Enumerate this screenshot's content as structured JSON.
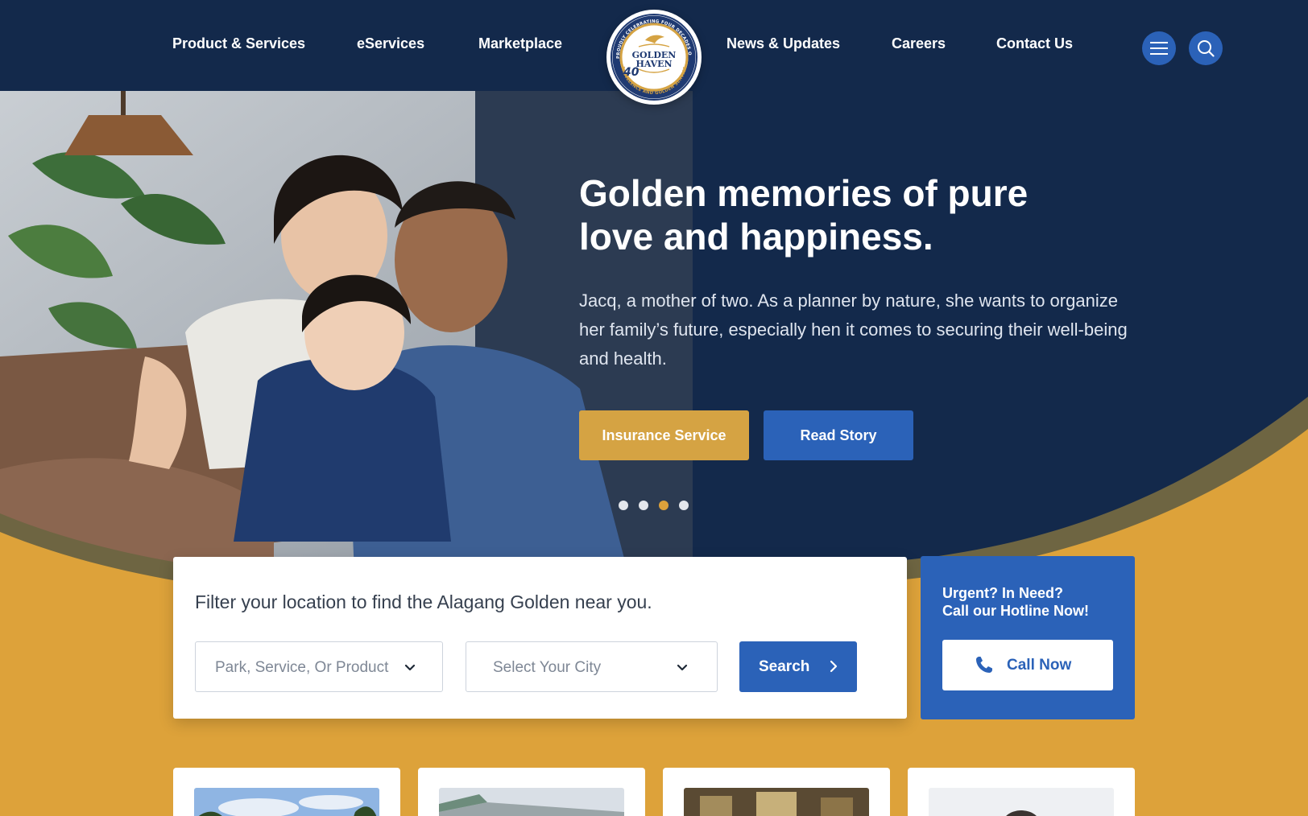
{
  "nav": {
    "left": [
      "Product & Services",
      "eServices",
      "Marketplace"
    ],
    "right": [
      "News & Updates",
      "Careers",
      "Contact Us"
    ],
    "icons": [
      "menu-icon",
      "search-icon"
    ]
  },
  "logo": {
    "line1": "GOLDEN",
    "line2": "HAVEN",
    "badge": "40",
    "ring_top": "PROUDLY CELEBRATING FOUR DECADES OF",
    "ring_bottom": "EXCELLENCE AND GOLDEN SERVICE"
  },
  "hero": {
    "title": "Golden memories of pure love and happiness.",
    "text": "Jacq, a mother of two. As a planner by nature, she wants to organize her family’s future, especially hen it comes to securing their well-being and health.",
    "primary_button": "Insurance Service",
    "secondary_button": "Read Story",
    "slides": {
      "count": 4,
      "active_index": 2
    }
  },
  "filter": {
    "title": "Filter your location to find the Alagang Golden near you.",
    "product_placeholder": "Park, Service, Or Product",
    "city_placeholder": "Select Your City",
    "search_button": "Search"
  },
  "hotline": {
    "line1": "Urgent? In Need?",
    "line2": "Call our Hotline Now!",
    "button": "Call Now"
  },
  "colors": {
    "navy": "#13294b",
    "gold": "#dda23a",
    "blue": "#2b62b8",
    "button_gold": "#d5a343"
  }
}
